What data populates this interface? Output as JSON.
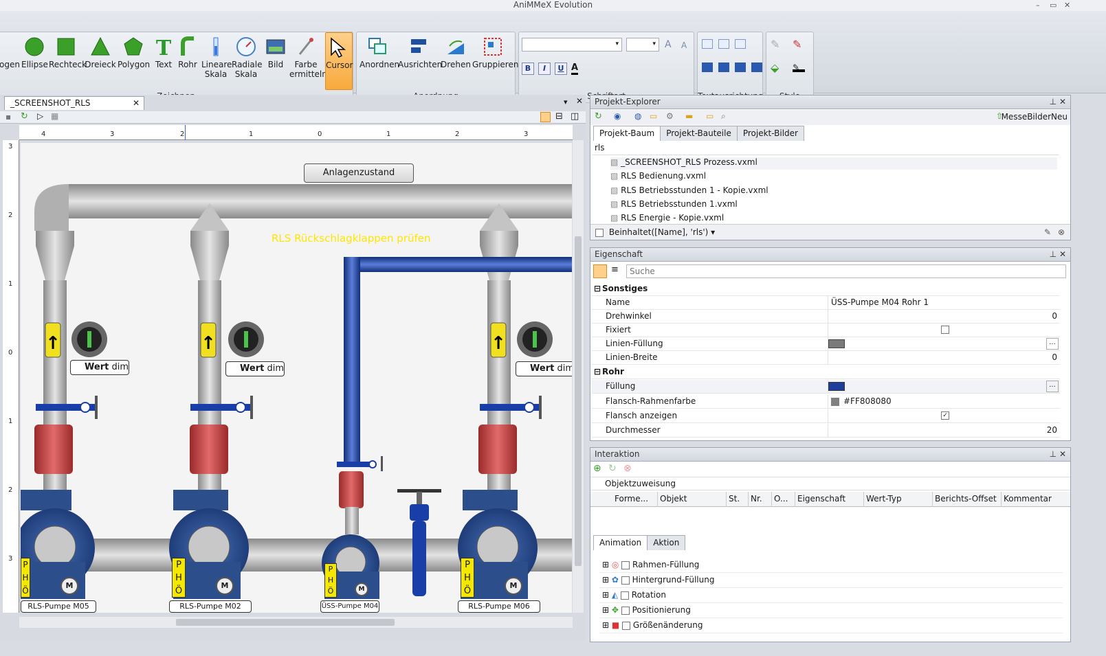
{
  "app": {
    "title": "AniMMeX Evolution"
  },
  "ribbon": {
    "zeichnen": {
      "label": "Zeichnen",
      "buttons": [
        "ogen",
        "Ellipse",
        "Rechteck",
        "Dreieck",
        "Polygon",
        "Text",
        "Rohr",
        "Lineare\nSkala",
        "Radiale\nSkala",
        "Bild",
        "Farbe\nermitteln",
        "Cursor"
      ]
    },
    "anordnung": {
      "label": "Anordnung",
      "buttons": [
        "Anordnen",
        "Ausrichten",
        "Drehen",
        "Gruppieren"
      ]
    },
    "schriftart": {
      "label": "Schriftart"
    },
    "textausrichtung": {
      "label": "Textausrichtung"
    },
    "style": {
      "label": "Style"
    }
  },
  "document": {
    "tab_label": "_SCREENSHOT_RLS Prozess.vxml *",
    "ruler_h": [
      "4",
      "3",
      "2",
      "1",
      "0",
      "1",
      "2",
      "3"
    ],
    "ruler_v": [
      "3",
      "2",
      "1",
      "0",
      "1",
      "2",
      "3"
    ],
    "header_button": "Anlagenzustand",
    "caption": "RLS Rückschlagklappen prüfen",
    "value_label": "Wert",
    "value_unit": "dim",
    "pumps": [
      "RLS-Pumpe M05",
      "RLS-Pumpe M02",
      "ÜSS-Pumpe M04",
      "RLS-Pumpe M06"
    ],
    "pho": [
      "P",
      "H",
      "Ö"
    ],
    "motor": "M"
  },
  "explorer": {
    "title": "Projekt-Explorer",
    "project": "MesseBilderNeu",
    "tabs": [
      "Projekt-Baum",
      "Projekt-Bauteile",
      "Projekt-Bilder"
    ],
    "filter_text": "rls",
    "files": [
      "_SCREENSHOT_RLS Prozess.vxml",
      "RLS Bedienung.vxml",
      "RLS Betriebsstunden 1 - Kopie.vxml",
      "RLS Betriebsstunden 1.vxml",
      "RLS Energie - Kopie.vxml"
    ],
    "filter_expr": "Beinhaltet([Name], 'rls')"
  },
  "properties": {
    "title": "Eigenschaft",
    "search_placeholder": "Suche",
    "cat1": "Sonstiges",
    "cat2": "Rohr",
    "rows": [
      {
        "name": "Name",
        "value": "ÜSS-Pumpe M04 Rohr 1"
      },
      {
        "name": "Drehwinkel",
        "value": "0"
      },
      {
        "name": "Fixiert",
        "value": ""
      },
      {
        "name": "Linien-Füllung",
        "value": ""
      },
      {
        "name": "Linien-Breite",
        "value": "0"
      },
      {
        "name": "Füllung",
        "value": ""
      },
      {
        "name": "Flansch-Rahmenfarbe",
        "value": "#FF808080"
      },
      {
        "name": "Flansch anzeigen",
        "value": ""
      },
      {
        "name": "Durchmesser",
        "value": "20"
      }
    ]
  },
  "interaction": {
    "title": "Interaktion",
    "assignment": "Objektzuweisung",
    "columns": [
      "Forme...",
      "Objekt",
      "St.",
      "Nr.",
      "O...",
      "Eigenschaft",
      "Wert-Typ",
      "Berichts-Offset",
      "Kommentar"
    ],
    "tabs": [
      "Animation",
      "Aktion"
    ],
    "animations": [
      "Rahmen-Füllung",
      "Hintergrund-Füllung",
      "Rotation",
      "Positionierung",
      "Größenänderung"
    ]
  },
  "colors": {
    "accent": "#f7a93c",
    "pipe": "#b8b8b8",
    "bluepipe": "#1d3f9a",
    "valve": "#c84444",
    "pump": "#2c4f8c",
    "caption": "#ffe600"
  }
}
